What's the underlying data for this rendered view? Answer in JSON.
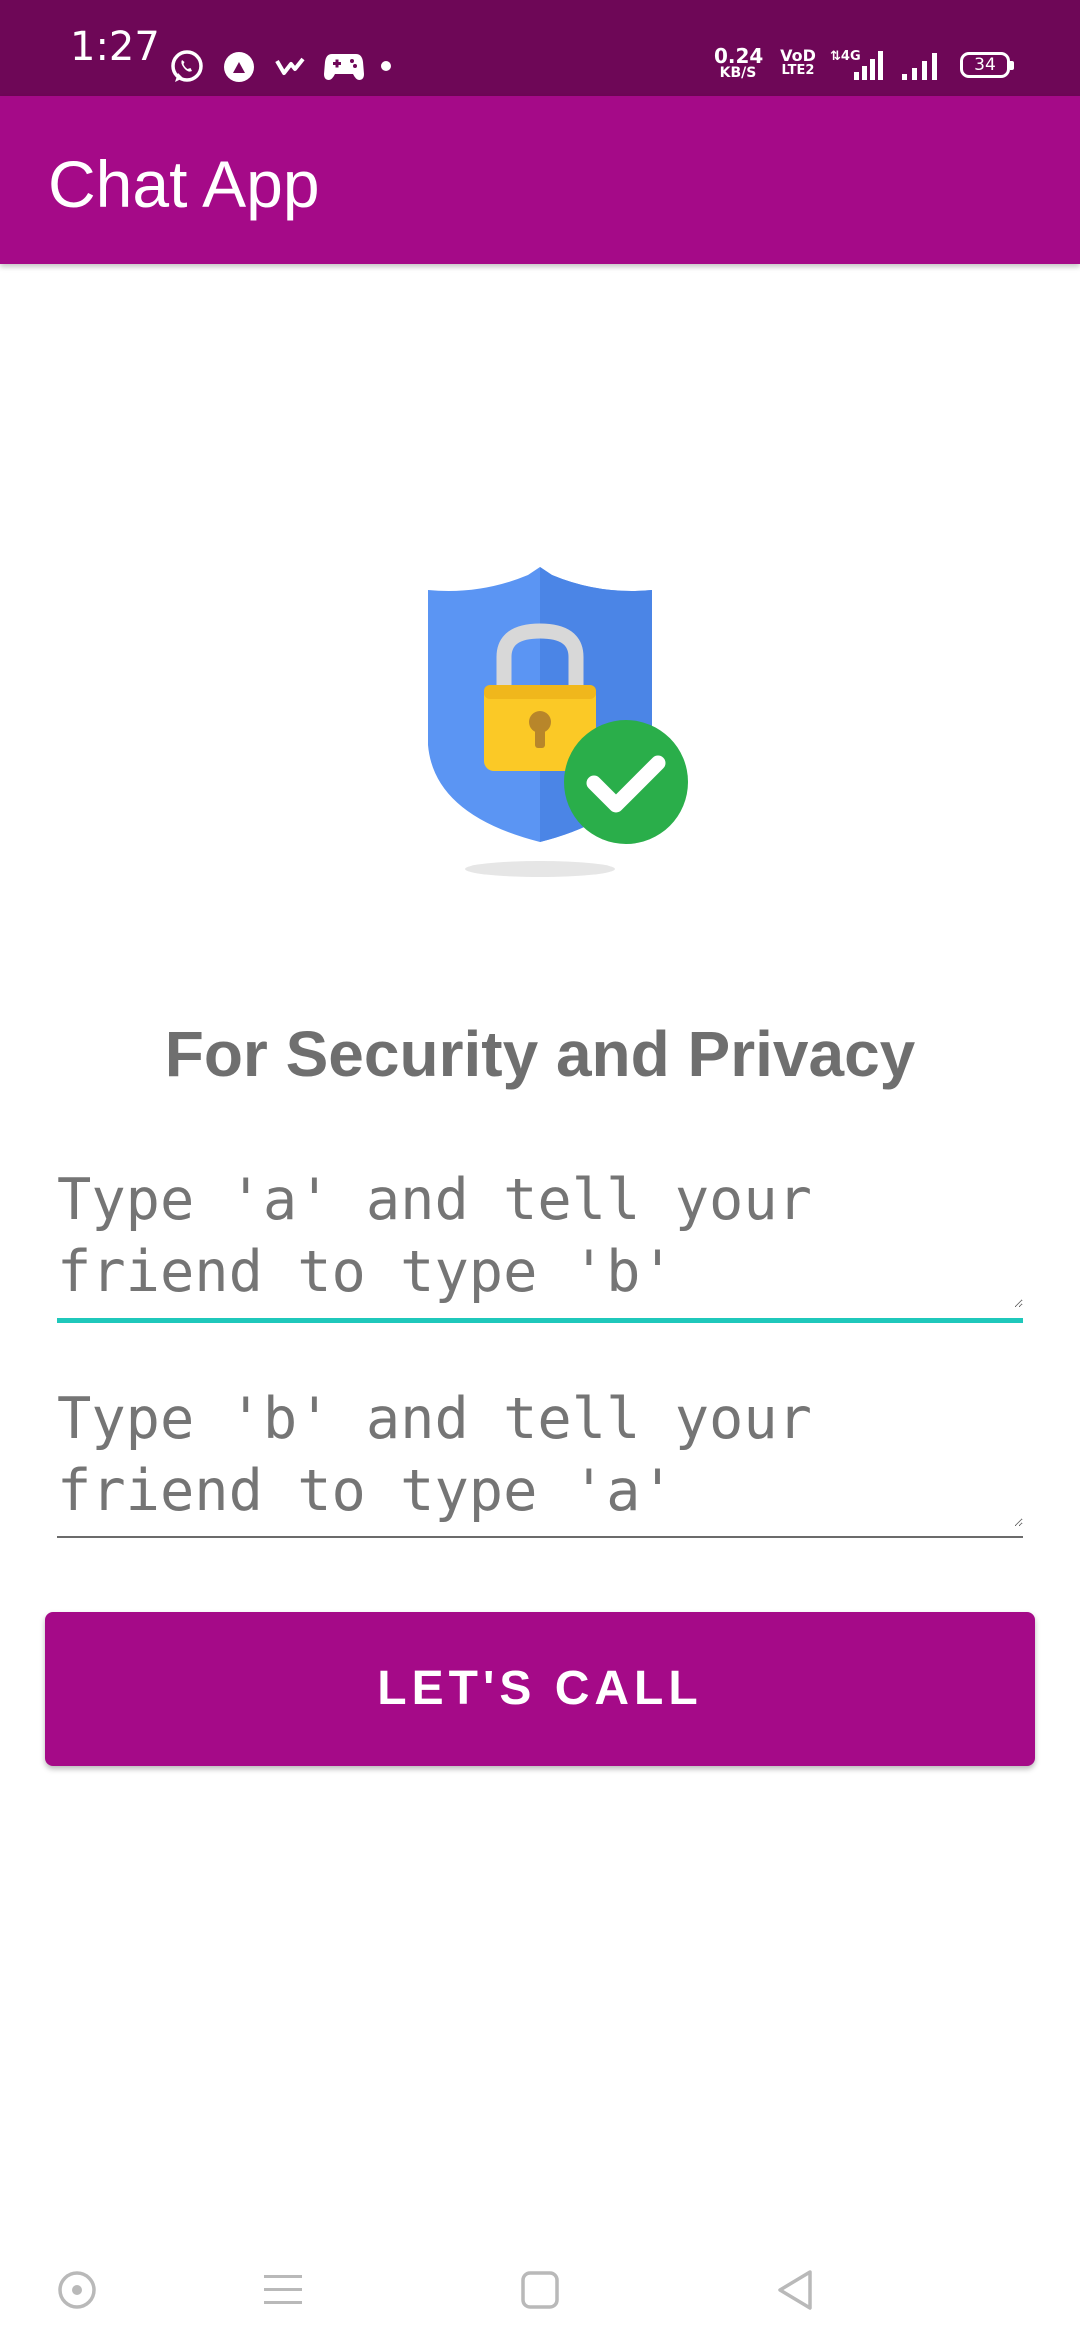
{
  "status_bar": {
    "time": "1:27",
    "net_speed_value": "0.24",
    "net_speed_unit": "KB/S",
    "volte_top": "VoD",
    "volte_bottom": "LTE2",
    "battery": "34",
    "left_icons": [
      "whatsapp-icon",
      "drive-icon",
      "check-mark-icon",
      "gamepad-icon",
      "dot-icon"
    ],
    "right_icons": [
      "volte-icon",
      "signal-4g-icon",
      "signal-icon",
      "battery-icon"
    ]
  },
  "app_bar": {
    "title": "Chat App"
  },
  "main": {
    "illustration_icon": "shield-lock-check-icon",
    "heading": "For Security and Privacy",
    "field_a": {
      "placeholder": "Type 'a' and tell your friend to type 'b'",
      "value": ""
    },
    "field_b": {
      "placeholder": "Type 'b' and tell your friend to type 'a'",
      "value": ""
    },
    "call_button": "LET'S CALL"
  },
  "nav_bar": {
    "buttons": [
      "assistant-icon",
      "menu-icon",
      "home-icon",
      "back-icon"
    ]
  },
  "colors": {
    "status_bar": "#6e0757",
    "primary": "#a50a88",
    "accent": "#1fc8bb",
    "heading_text": "#6f6f6f",
    "hint_text": "#9e9e9e",
    "shield_blue": "#4f8ef0",
    "lock_yellow": "#fbc926",
    "check_green": "#27ac48"
  }
}
